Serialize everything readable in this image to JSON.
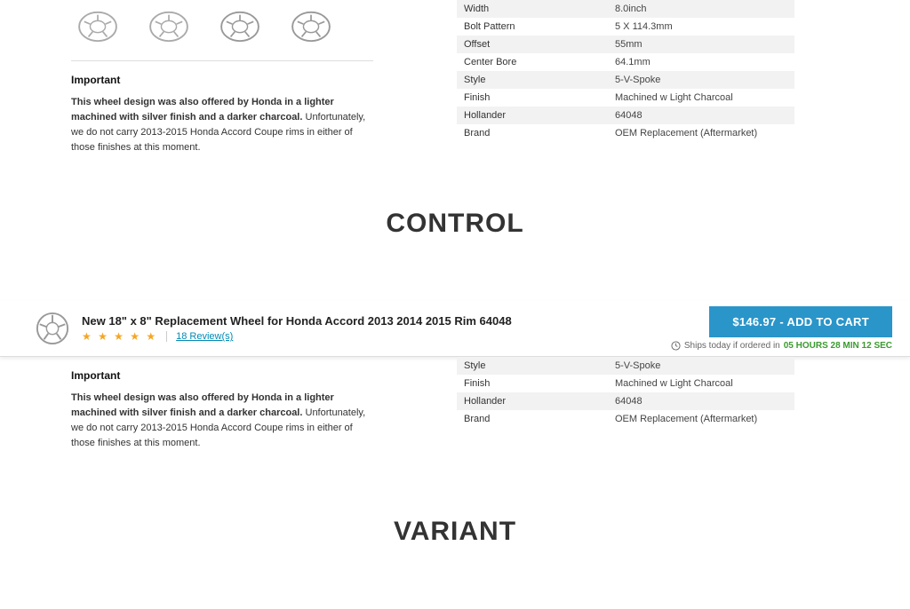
{
  "control": {
    "important_heading": "Important",
    "important_bold": "This wheel design was also offered by Honda in a lighter machined with silver finish and a darker charcoal.",
    "important_rest": " Unfortunately, we do not carry 2013-2015 Honda Accord Coupe rims in either of those finishes at this moment.",
    "specs": [
      {
        "label": "Width",
        "value": "8.0inch"
      },
      {
        "label": "Bolt Pattern",
        "value": "5 X 114.3mm"
      },
      {
        "label": "Offset",
        "value": "55mm"
      },
      {
        "label": "Center Bore",
        "value": "64.1mm"
      },
      {
        "label": "Style",
        "value": "5-V-Spoke"
      },
      {
        "label": "Finish",
        "value": "Machined w Light Charcoal"
      },
      {
        "label": "Hollander",
        "value": "64048"
      },
      {
        "label": "Brand",
        "value": "OEM Replacement (Aftermarket)"
      }
    ]
  },
  "labels": {
    "control": "CONTROL",
    "variant": "VARIANT"
  },
  "variant": {
    "title": "New 18\" x 8\" Replacement Wheel for Honda Accord 2013 2014 2015 Rim 64048",
    "stars": "★ ★ ★ ★ ★",
    "reviews_link": "18 Review(s)",
    "cart_button": "$146.97 - ADD TO CART",
    "ship_prefix": "Ships today if ordered in ",
    "ship_countdown": "05 HOURS 28 MIN 12 SEC",
    "important_heading": "Important",
    "important_bold": "This wheel design was also offered by Honda in a lighter machined with silver finish and a darker charcoal.",
    "important_rest": " Unfortunately, we do not carry 2013-2015 Honda Accord Coupe rims in either of those finishes at this moment.",
    "specs": [
      {
        "label": "Style",
        "value": "5-V-Spoke"
      },
      {
        "label": "Finish",
        "value": "Machined w Light Charcoal"
      },
      {
        "label": "Hollander",
        "value": "64048"
      },
      {
        "label": "Brand",
        "value": "OEM Replacement (Aftermarket)"
      }
    ]
  }
}
